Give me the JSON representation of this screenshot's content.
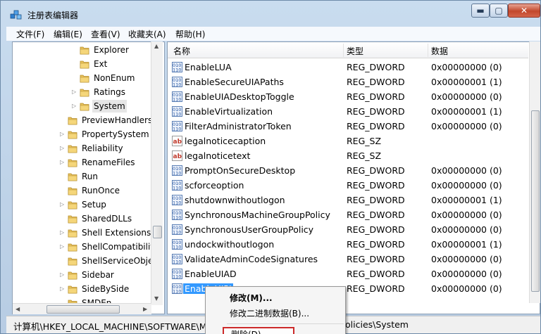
{
  "window": {
    "title": "注册表编辑器",
    "buttons": {
      "minimize": "▬",
      "maximize": "▢",
      "close": "✕"
    }
  },
  "menu": [
    "文件(F)",
    "编辑(E)",
    "查看(V)",
    "收藏夹(A)",
    "帮助(H)"
  ],
  "tree": {
    "items": [
      {
        "label": "Explorer",
        "expander": "",
        "selected": false
      },
      {
        "label": "Ext",
        "expander": "",
        "selected": false
      },
      {
        "label": "NonEnum",
        "expander": "",
        "selected": false
      },
      {
        "label": "Ratings",
        "expander": "▷",
        "selected": false
      },
      {
        "label": "System",
        "expander": "▷",
        "selected": true
      },
      {
        "label": "PreviewHandlers",
        "expander": "",
        "selected": false
      },
      {
        "label": "PropertySystem",
        "expander": "▷",
        "selected": false
      },
      {
        "label": "Reliability",
        "expander": "▷",
        "selected": false
      },
      {
        "label": "RenameFiles",
        "expander": "▷",
        "selected": false
      },
      {
        "label": "Run",
        "expander": "",
        "selected": false
      },
      {
        "label": "RunOnce",
        "expander": "",
        "selected": false
      },
      {
        "label": "Setup",
        "expander": "▷",
        "selected": false
      },
      {
        "label": "SharedDLLs",
        "expander": "",
        "selected": false
      },
      {
        "label": "Shell Extensions",
        "expander": "▷",
        "selected": false
      },
      {
        "label": "ShellCompatibility",
        "expander": "▷",
        "selected": false
      },
      {
        "label": "ShellServiceObjec",
        "expander": "",
        "selected": false
      },
      {
        "label": "Sidebar",
        "expander": "▷",
        "selected": false
      },
      {
        "label": "SideBySide",
        "expander": "▷",
        "selected": false
      },
      {
        "label": "SMDEn",
        "expander": "",
        "selected": false
      }
    ]
  },
  "list": {
    "columns": {
      "name": "名称",
      "type": "类型",
      "data": "数据"
    },
    "rows": [
      {
        "name": "EnableLUA",
        "type": "REG_DWORD",
        "data": "0x00000000 (0)",
        "icon": "dword"
      },
      {
        "name": "EnableSecureUIAPaths",
        "type": "REG_DWORD",
        "data": "0x00000001 (1)",
        "icon": "dword"
      },
      {
        "name": "EnableUIADesktopToggle",
        "type": "REG_DWORD",
        "data": "0x00000000 (0)",
        "icon": "dword"
      },
      {
        "name": "EnableVirtualization",
        "type": "REG_DWORD",
        "data": "0x00000001 (1)",
        "icon": "dword"
      },
      {
        "name": "FilterAdministratorToken",
        "type": "REG_DWORD",
        "data": "0x00000000 (0)",
        "icon": "dword"
      },
      {
        "name": "legalnoticecaption",
        "type": "REG_SZ",
        "data": "",
        "icon": "string"
      },
      {
        "name": "legalnoticetext",
        "type": "REG_SZ",
        "data": "",
        "icon": "string"
      },
      {
        "name": "PromptOnSecureDesktop",
        "type": "REG_DWORD",
        "data": "0x00000000 (0)",
        "icon": "dword"
      },
      {
        "name": "scforceoption",
        "type": "REG_DWORD",
        "data": "0x00000000 (0)",
        "icon": "dword"
      },
      {
        "name": "shutdownwithoutlogon",
        "type": "REG_DWORD",
        "data": "0x00000001 (1)",
        "icon": "dword"
      },
      {
        "name": "SynchronousMachineGroupPolicy",
        "type": "REG_DWORD",
        "data": "0x00000000 (0)",
        "icon": "dword"
      },
      {
        "name": "SynchronousUserGroupPolicy",
        "type": "REG_DWORD",
        "data": "0x00000000 (0)",
        "icon": "dword"
      },
      {
        "name": "undockwithoutlogon",
        "type": "REG_DWORD",
        "data": "0x00000001 (1)",
        "icon": "dword"
      },
      {
        "name": "ValidateAdminCodeSignatures",
        "type": "REG_DWORD",
        "data": "0x00000000 (0)",
        "icon": "dword"
      },
      {
        "name": "EnableUIAD",
        "type": "REG_DWORD",
        "data": "0x00000000 (0)",
        "icon": "dword"
      },
      {
        "name": "EnableUIPI",
        "type": "REG_DWORD",
        "data": "0x00000000 (0)",
        "icon": "dword",
        "selected": true
      }
    ]
  },
  "status": {
    "path_start": "计算机\\HKEY_LOCAL_MACHINE\\SOFTWARE\\Mic",
    "path_end": "olicies\\System"
  },
  "context_menu": {
    "modify": "修改(M)...",
    "modify_binary": "修改二进制数据(B)...",
    "delete": "删除(D)"
  },
  "colors": {
    "selection": "#3399ff",
    "delete_highlight": "#cc2a2a"
  }
}
